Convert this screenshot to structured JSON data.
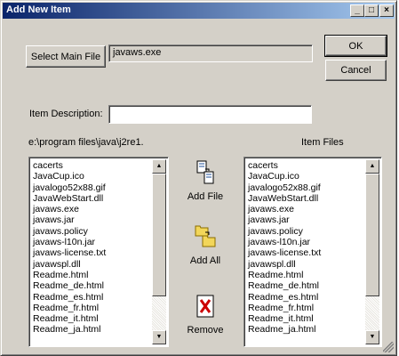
{
  "window": {
    "title": "Add New Item",
    "controls": {
      "minimize": "_",
      "maximize": "□",
      "close": "×"
    }
  },
  "buttons": {
    "select_main_file": "Select Main File",
    "ok": "OK",
    "cancel": "Cancel"
  },
  "main_file": {
    "value": "javaws.exe"
  },
  "description": {
    "label": "Item Description:",
    "value": ""
  },
  "source": {
    "path": "e:\\program files\\java\\j2re1.",
    "items": [
      "cacerts",
      "JavaCup.ico",
      "javalogo52x88.gif",
      "JavaWebStart.dll",
      "javaws.exe",
      "javaws.jar",
      "javaws.policy",
      "javaws-l10n.jar",
      "javaws-license.txt",
      "javawspl.dll",
      "Readme.html",
      "Readme_de.html",
      "Readme_es.html",
      "Readme_fr.html",
      "Readme_it.html",
      "Readme_ja.html"
    ]
  },
  "item_files": {
    "label": "Item Files",
    "items": [
      "cacerts",
      "JavaCup.ico",
      "javalogo52x88.gif",
      "JavaWebStart.dll",
      "javaws.exe",
      "javaws.jar",
      "javaws.policy",
      "javaws-l10n.jar",
      "javaws-license.txt",
      "javawspl.dll",
      "Readme.html",
      "Readme_de.html",
      "Readme_es.html",
      "Readme_fr.html",
      "Readme_it.html",
      "Readme_ja.html"
    ]
  },
  "actions": {
    "add_file": {
      "label": "Add File",
      "icon": "add-file-icon"
    },
    "add_all": {
      "label": "Add All",
      "icon": "folder-copy-icon"
    },
    "remove": {
      "label": "Remove",
      "icon": "red-x-icon"
    }
  },
  "colors": {
    "title_start": "#0a246a",
    "title_end": "#a6caf0",
    "face": "#d4d0c8",
    "remove_red": "#cc0000",
    "folder_yellow": "#f2d65a"
  }
}
